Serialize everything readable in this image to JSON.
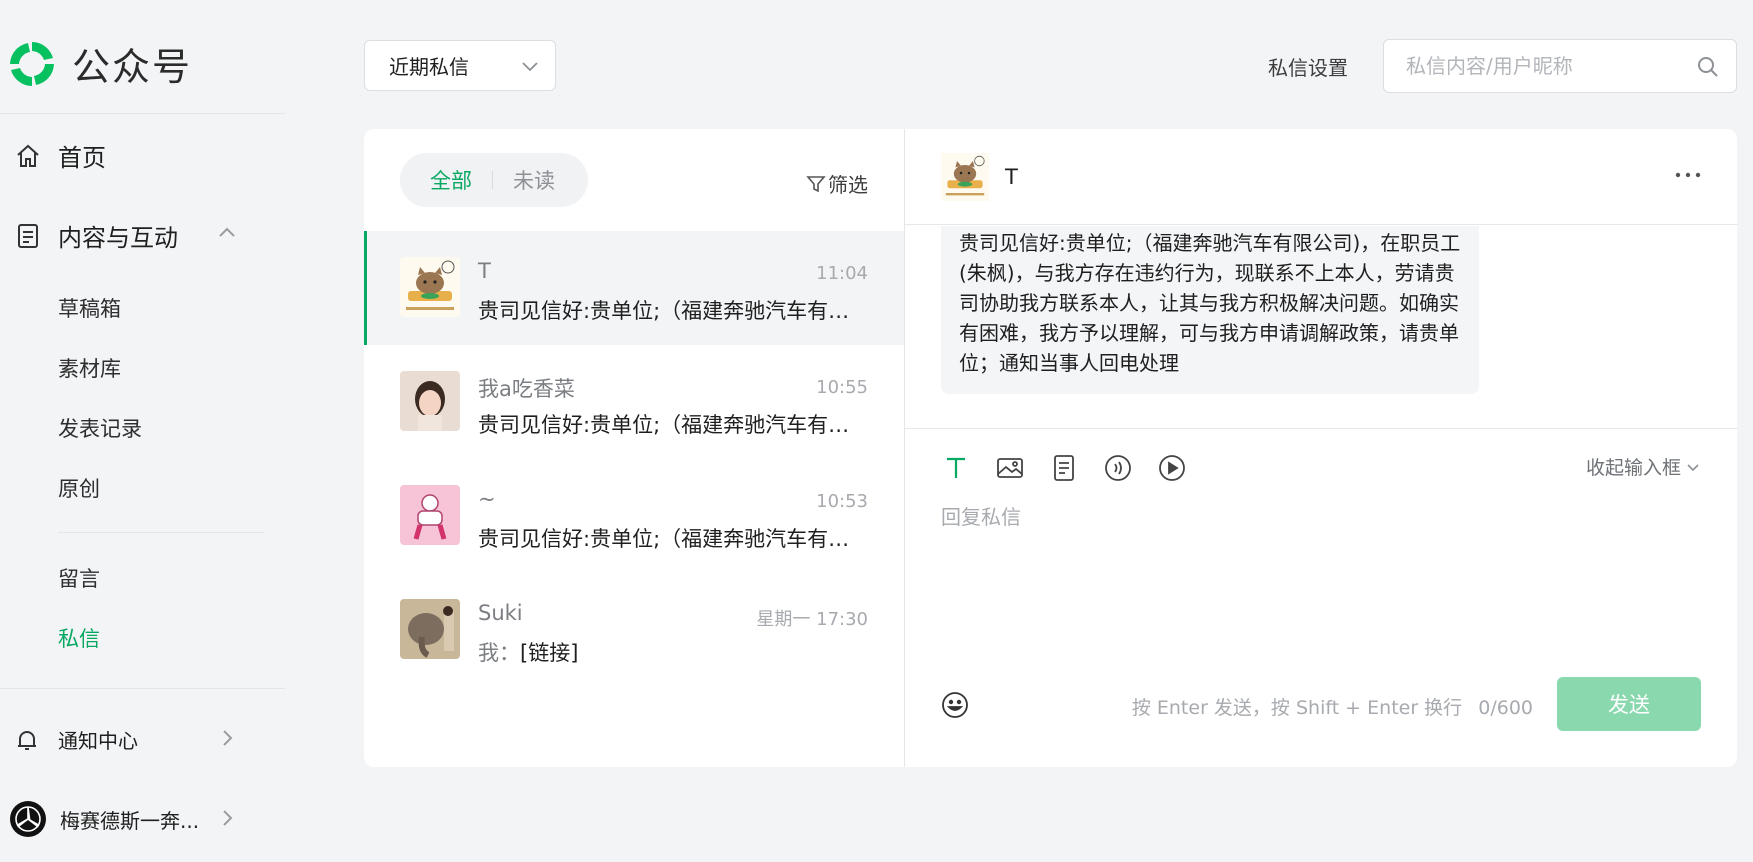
{
  "brand": {
    "name": "公众号",
    "accent": "#07a862"
  },
  "sidebar": {
    "home": "首页",
    "content": "内容与互动",
    "sub_items": [
      "草稿箱",
      "素材库",
      "发表记录",
      "原创"
    ],
    "sub_items2": [
      "留言",
      "私信"
    ],
    "notifications": "通知中心",
    "account": "梅赛德斯一奔..."
  },
  "topbar": {
    "filter_select": "近期私信",
    "settings": "私信设置",
    "search_placeholder": "私信内容/用户昵称"
  },
  "list": {
    "tabs": [
      "全部",
      "未读"
    ],
    "filter": "筛选",
    "conversations": [
      {
        "name": "T",
        "time": "11:04",
        "preview": "贵司见信好:贵单位;（福建奔驰汽车有限公司)，在职员工(朱枫)，与我方存在违约行为",
        "prefix": ""
      },
      {
        "name": "我a吃香菜",
        "time": "10:55",
        "preview": "贵司见信好:贵单位;（福建奔驰汽车有限公司)，在职员工(朱枫)，与我方存在违约行为",
        "prefix": ""
      },
      {
        "name": "~",
        "time": "10:53",
        "preview": "贵司见信好:贵单位;（福建奔驰汽车有限公司)，在职员工(朱枫)，与我方存在违约行为",
        "prefix": ""
      },
      {
        "name": "Suki",
        "time": "星期一 17:30",
        "preview": "[链接]",
        "prefix": "我："
      }
    ]
  },
  "chat": {
    "contact": "T",
    "message": "贵司见信好:贵单位;（福建奔驰汽车有限公司)，在职员工(朱枫)，与我方存在违约行为，现联系不上本人，劳请贵司协助我方联系本人，让其与我方积极解决问题。如确实有困难，我方予以理解，可与我方申请调解政策，请贵单位；通知当事人回电处理",
    "collapse": "收起输入框",
    "reply_placeholder": "回复私信",
    "hint": "按 Enter 发送，按 Shift + Enter 换行",
    "counter": "0/600",
    "send": "发送"
  }
}
